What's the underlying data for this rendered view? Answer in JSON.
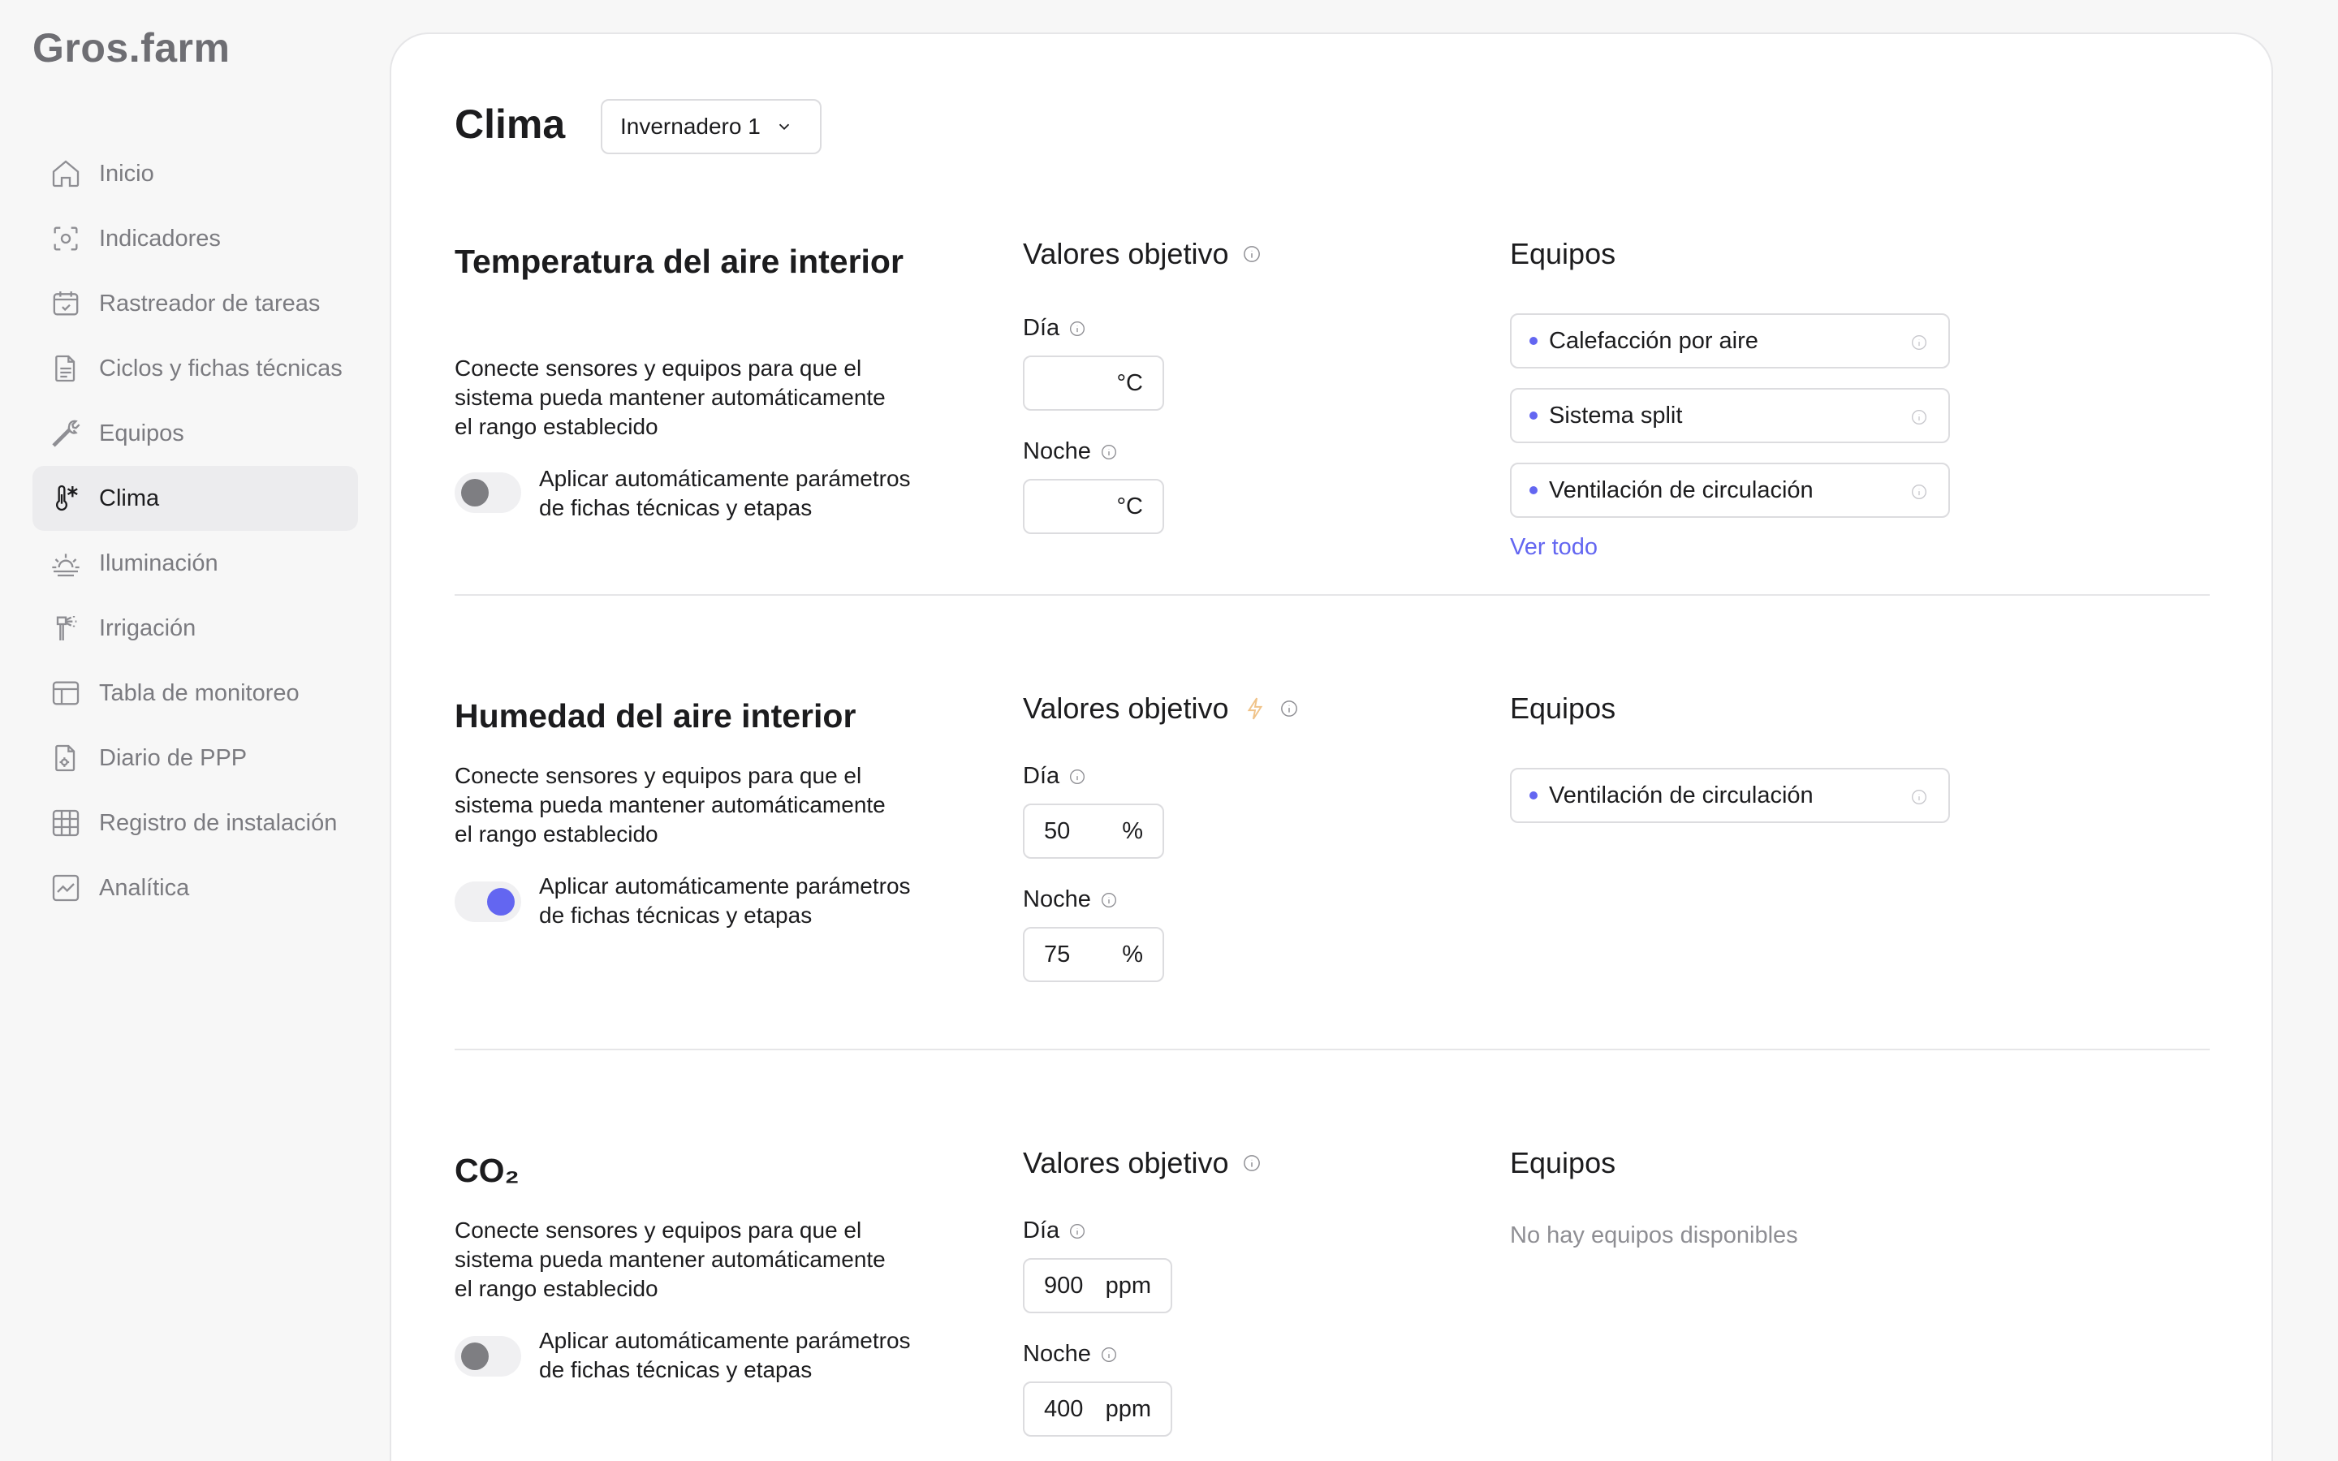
{
  "app": {
    "logo": "Gros.farm"
  },
  "nav": {
    "items": [
      {
        "label": "Inicio",
        "icon": "home-icon"
      },
      {
        "label": "Indicadores",
        "icon": "sensor-icon"
      },
      {
        "label": "Rastreador de tareas",
        "icon": "calendar-check-icon"
      },
      {
        "label": "Ciclos y fichas técnicas",
        "icon": "document-icon"
      },
      {
        "label": "Equipos",
        "icon": "wrench-icon"
      },
      {
        "label": "Clima",
        "icon": "thermometer-icon",
        "active": true
      },
      {
        "label": "Iluminación",
        "icon": "sunrise-icon"
      },
      {
        "label": "Irrigación",
        "icon": "sprinkler-icon"
      },
      {
        "label": "Tabla de monitoreo",
        "icon": "table-icon"
      },
      {
        "label": "Diario de PPP",
        "icon": "document-gear-icon"
      },
      {
        "label": "Registro de instalación",
        "icon": "grid-icon"
      },
      {
        "label": "Analítica",
        "icon": "chart-icon"
      }
    ]
  },
  "page": {
    "title": "Clima",
    "greenhouse": "Invernadero 1"
  },
  "sections": [
    {
      "title": "Temperatura del aire interior",
      "desc": "Conecte sensores y equipos para que el sistema pueda mantener automáticamente el rango establecido",
      "toggle_label": "Aplicar automáticamente parámetros de fichas técnicas y etapas",
      "toggle_on": false,
      "objective_title": "Valores objetivo",
      "day_label": "Día",
      "night_label": "Noche",
      "day_value": "",
      "night_value": "",
      "unit": "°C",
      "equipment_title": "Equipos",
      "equipment": [
        "Calefacción por aire",
        "Sistema split",
        "Ventilación de circulación"
      ],
      "see_all": "Ver todo"
    },
    {
      "title": "Humedad del aire interior",
      "desc": "Conecte sensores y equipos para que el sistema pueda mantener automáticamente el rango establecido",
      "toggle_label": "Aplicar automáticamente parámetros de fichas técnicas y etapas",
      "toggle_on": true,
      "objective_title": "Valores objetivo",
      "day_label": "Día",
      "night_label": "Noche",
      "day_value": "50",
      "night_value": "75",
      "unit": "%",
      "equipment_title": "Equipos",
      "equipment": [
        "Ventilación de circulación"
      ]
    },
    {
      "title": "CO₂",
      "desc": "Conecte sensores y equipos para que el sistema pueda mantener automáticamente el rango establecido",
      "toggle_label": "Aplicar automáticamente parámetros de fichas técnicas y etapas",
      "toggle_on": false,
      "objective_title": "Valores objetivo",
      "day_label": "Día",
      "night_label": "Noche",
      "day_value": "900",
      "night_value": "400",
      "unit": "ppm",
      "equipment_title": "Equipos",
      "no_equipment": "No hay equipos disponibles"
    }
  ],
  "colors": {
    "accent": "#6366f1",
    "bolt": "#f0c389",
    "muted": "#8e8e93"
  }
}
